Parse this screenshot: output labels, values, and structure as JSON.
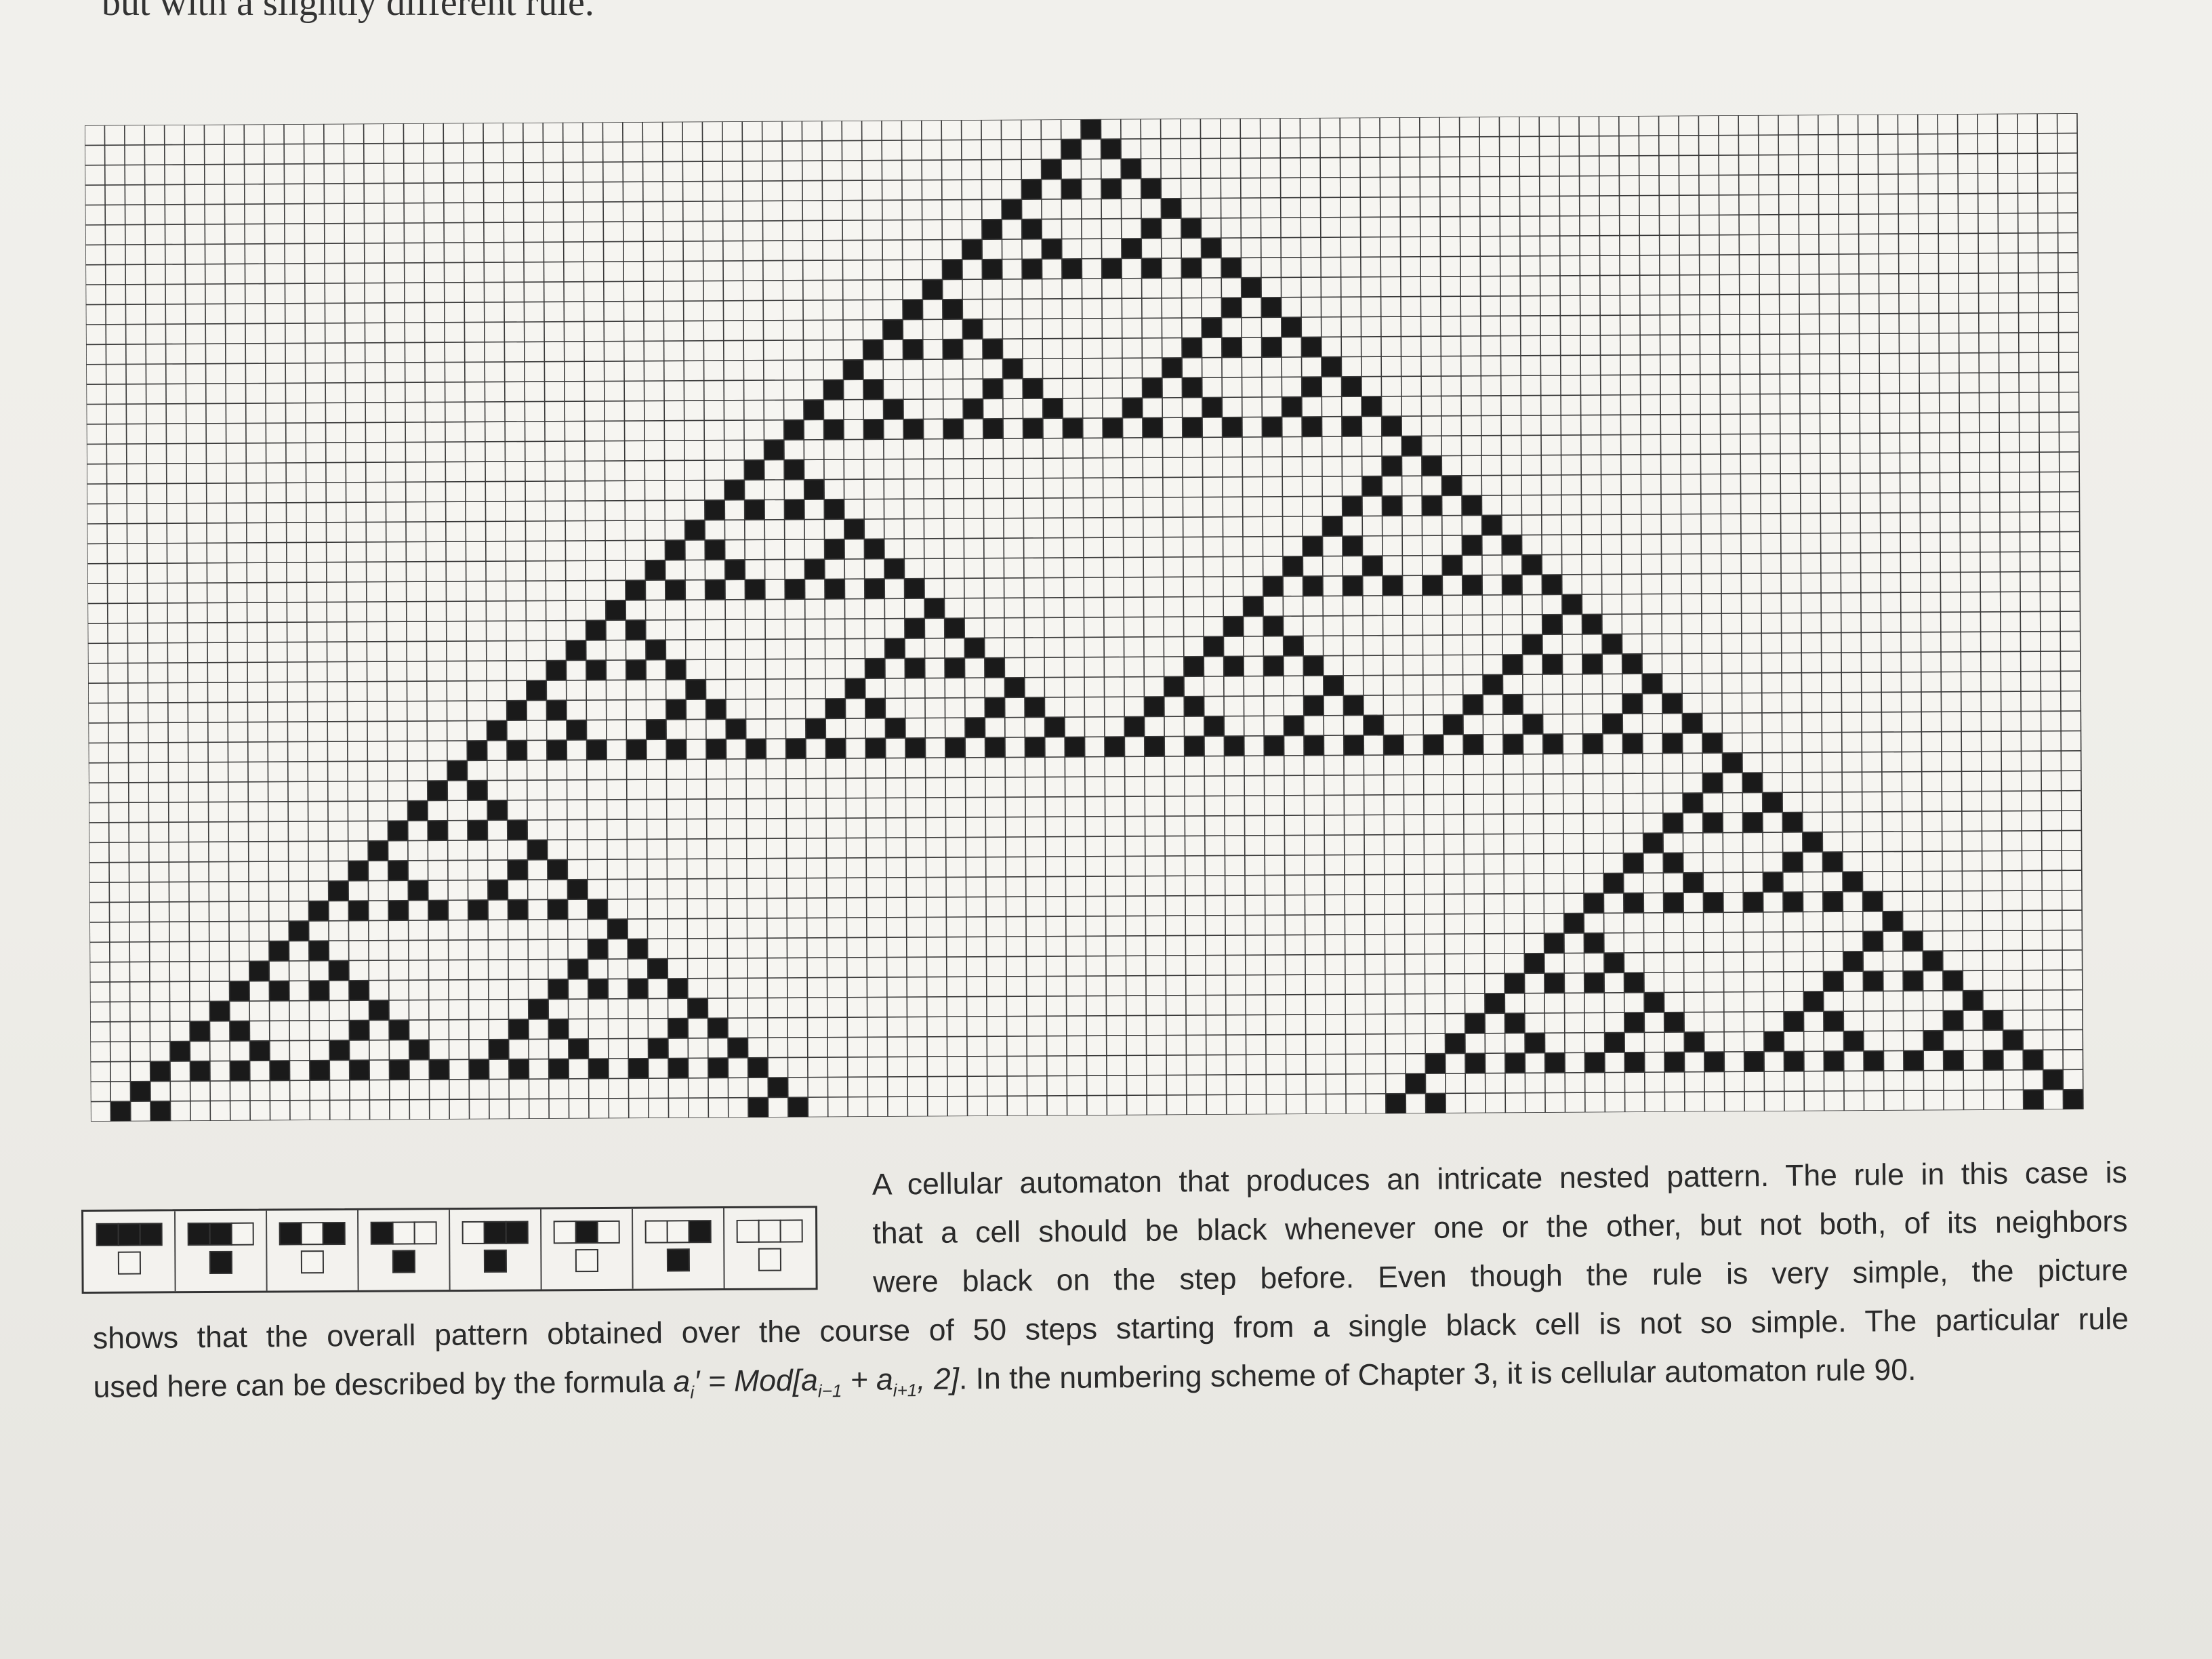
{
  "page": {
    "top_text": "but with a slightly different rule."
  },
  "automaton": {
    "rule_number": 90,
    "steps": 50,
    "initial_black_cells": 1,
    "colors": {
      "black": "#1a1a1a",
      "white": "#f6f5f1",
      "grid": "#3a3a3a"
    }
  },
  "rule_icons": [
    {
      "neighborhood": "■■■",
      "result": "white"
    },
    {
      "neighborhood": "■■□",
      "result": "black"
    },
    {
      "neighborhood": "■□■",
      "result": "white"
    },
    {
      "neighborhood": "■□□",
      "result": "black"
    },
    {
      "neighborhood": "□■■",
      "result": "black"
    },
    {
      "neighborhood": "□■□",
      "result": "white"
    },
    {
      "neighborhood": "□□■",
      "result": "black"
    },
    {
      "neighborhood": "□□□",
      "result": "white"
    }
  ],
  "caption": {
    "line1": "A cellular automaton that produces an intricate nested pattern. The rule in this case is",
    "line2": "that a cell should be black whenever one or the other, but not both, of its neighbors",
    "line3": "were black on the step before. Even though the rule is very simple, the picture",
    "line4": "shows that the overall pattern obtained over the course of 50 steps starting from a single black cell is not so simple. The particular rule",
    "line5_pre": "used here can be described by the formula",
    "formula": {
      "lhs": "a",
      "lhs_sub": "i",
      "prime": "′",
      "eq": " = Mod[",
      "t1": "a",
      "t1_sub": "i−1",
      "plus": " + ",
      "t2": "a",
      "t2_sub": "i+1",
      "tail": ", 2]"
    },
    "line5_post": ". In the numbering scheme of Chapter 3, it is cellular automaton rule 90."
  }
}
